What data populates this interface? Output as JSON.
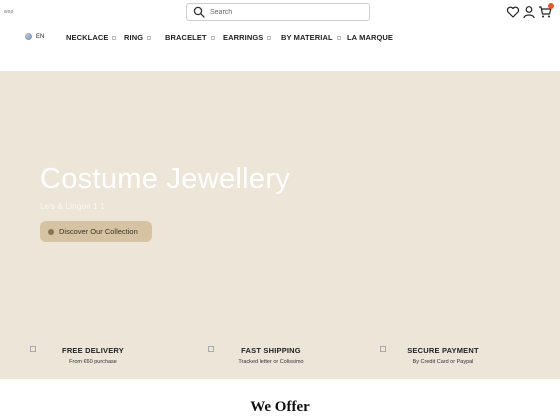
{
  "header": {
    "logo_text": "wsp",
    "search_placeholder": "Search"
  },
  "icons": {
    "search": "search-icon",
    "wishlist": "heart-icon",
    "account": "user-icon",
    "cart": "cart-icon",
    "language": "globe-icon"
  },
  "nav": {
    "language": "EN",
    "items": [
      {
        "label": "NECKLACE",
        "has_dropdown": true
      },
      {
        "label": "RING",
        "has_dropdown": true
      },
      {
        "label": "BRACELET",
        "has_dropdown": true
      },
      {
        "label": "EARRINGS",
        "has_dropdown": true
      },
      {
        "label": "BY MATERIAL",
        "has_dropdown": true
      },
      {
        "label": "LA MARQUE",
        "has_dropdown": false
      }
    ]
  },
  "hero": {
    "title": "Costume Jewellery",
    "subtitle": "Le's & Lingon 1 1",
    "button_label": "Discover Our Collection"
  },
  "features": [
    {
      "title": "FREE DELIVERY",
      "desc": "From €60 purchase"
    },
    {
      "title": "FAST SHIPPING",
      "desc": "Tracked letter or Colissimo"
    },
    {
      "title": "SECURE PAYMENT",
      "desc": "By Credit Card or Paypal"
    }
  ],
  "section": {
    "title": "We Offer"
  },
  "colors": {
    "hero_bg": "#ece5d8",
    "button_bg": "#d6c3a3",
    "badge": "#e05a2a"
  }
}
